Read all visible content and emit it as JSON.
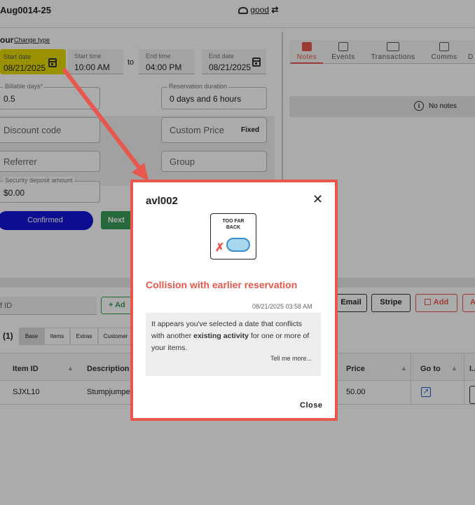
{
  "header": {
    "title": "Aug0014-25",
    "user": "good"
  },
  "form": {
    "heading": "our",
    "change_type": "Change type",
    "start_date_label": "Start date",
    "start_date": "08/21/2025",
    "start_time_label": "Start time",
    "start_time": "10:00 AM",
    "to": "to",
    "end_time_label": "End time",
    "end_time": "04:00 PM",
    "end_date_label": "End date",
    "end_date": "08/21/2025",
    "billable_label": "Billable days*",
    "billable": "0.5",
    "duration_label": "Reservation duration",
    "duration": "0 days and 6 hours",
    "discount_placeholder": "Discount code",
    "custom_price_placeholder": "Custom Price",
    "fixed": "Fixed",
    "referrer_placeholder": "Referrer",
    "group_placeholder": "Group",
    "deposit_label": "Security deposit amount",
    "deposit": "$0.00",
    "confirmed": "Confirmed",
    "next": "Next"
  },
  "tabs": [
    "Notes",
    "Events",
    "Transactions",
    "Comms",
    "D"
  ],
  "notes_empty": "No notes",
  "items_bar": {
    "id_placeholder": "f ID",
    "add": "+ Ad",
    "count": "(1)",
    "subtabs": [
      "Base",
      "Items",
      "Extras",
      "Customer"
    ],
    "email": "Email",
    "stripe": "Stripe",
    "add_btn": "Add",
    "a": "A"
  },
  "table": {
    "headers": [
      "Item ID",
      "Description",
      "Price",
      "Go to",
      "I.."
    ],
    "rows": [
      {
        "id": "SJXL10",
        "desc": "Stumpjumper",
        "price": "50.00"
      }
    ]
  },
  "modal": {
    "title": "avl002",
    "image_text": "TOO FAR BACK",
    "heading": "Collision with earlier reservation",
    "timestamp": "08/21/2025 03:58 AM",
    "msg_pre": "It appears you've selected a date that conflicts with another ",
    "msg_bold": "existing activity",
    "msg_post": " for one or more of your items.",
    "tell_more": "Tell me more...",
    "close": "Close"
  },
  "colors": {
    "accent_red": "#e8574d",
    "highlight": "#e6d800",
    "confirmed_blue": "#1414d8",
    "green": "#3a9d5a"
  }
}
